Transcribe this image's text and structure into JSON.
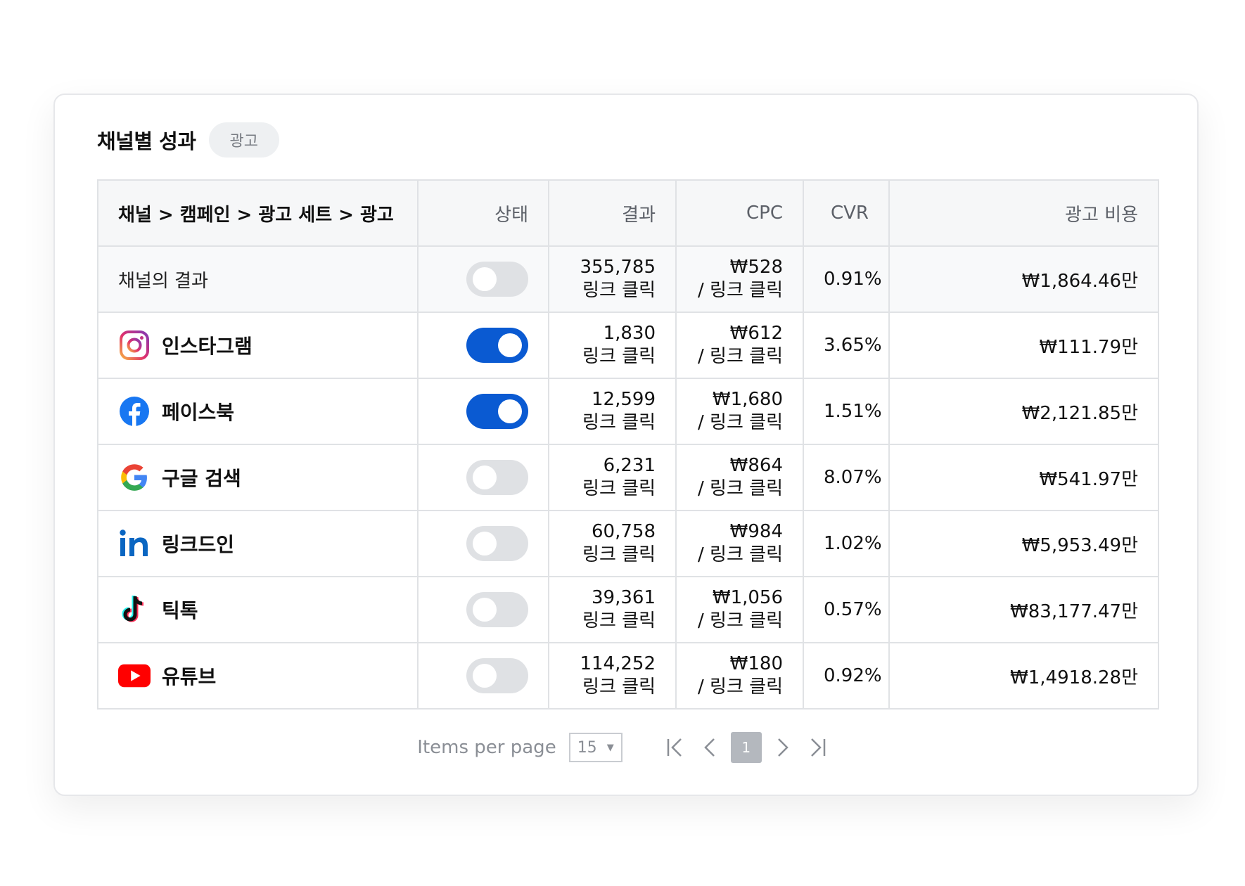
{
  "card": {
    "title": "채널별 성과",
    "tag": "광고"
  },
  "table": {
    "headers": {
      "name": "채널 > 캠페인 > 광고 세트 > 광고",
      "status": "상태",
      "result": "결과",
      "cpc": "CPC",
      "cvr": "CVR",
      "spend": "광고 비용"
    },
    "summary": {
      "name": "채널의 결과",
      "enabled": false,
      "result": "355,785",
      "result_unit": "링크 클릭",
      "cpc": "₩528",
      "cpc_unit": "/ 링크 클릭",
      "cvr": "0.91%",
      "spend": "₩1,864.46만"
    },
    "rows": [
      {
        "icon": "instagram-icon",
        "name": "인스타그램",
        "enabled": true,
        "result": "1,830",
        "result_unit": "링크 클릭",
        "cpc": "₩612",
        "cpc_unit": "/ 링크 클릭",
        "cvr": "3.65%",
        "spend": "₩111.79만"
      },
      {
        "icon": "facebook-icon",
        "name": "페이스북",
        "enabled": true,
        "result": "12,599",
        "result_unit": "링크 클릭",
        "cpc": "₩1,680",
        "cpc_unit": "/ 링크 클릭",
        "cvr": "1.51%",
        "spend": "₩2,121.85만"
      },
      {
        "icon": "google-icon",
        "name": "구글 검색",
        "enabled": false,
        "result": "6,231",
        "result_unit": "링크 클릭",
        "cpc": "₩864",
        "cpc_unit": "/ 링크 클릭",
        "cvr": "8.07%",
        "spend": "₩541.97만"
      },
      {
        "icon": "linkedin-icon",
        "name": "링크드인",
        "enabled": false,
        "result": "60,758",
        "result_unit": "링크 클릭",
        "cpc": "₩984",
        "cpc_unit": "/ 링크 클릭",
        "cvr": "1.02%",
        "spend": "₩5,953.49만"
      },
      {
        "icon": "tiktok-icon",
        "name": "틱톡",
        "enabled": false,
        "result": "39,361",
        "result_unit": "링크 클릭",
        "cpc": "₩1,056",
        "cpc_unit": "/ 링크 클릭",
        "cvr": "0.57%",
        "spend": "₩83,177.47만"
      },
      {
        "icon": "youtube-icon",
        "name": "유튜브",
        "enabled": false,
        "result": "114,252",
        "result_unit": "링크 클릭",
        "cpc": "₩180",
        "cpc_unit": "/ 링크 클릭",
        "cvr": "0.92%",
        "spend": "₩1,4918.28만"
      }
    ]
  },
  "pagination": {
    "items_per_page_label": "Items per page",
    "items_per_page": "15",
    "current_page": "1"
  },
  "colors": {
    "accent": "#0a5ad2",
    "toggle_off": "#dfe1e4",
    "page_current_bg": "#b4b8be"
  }
}
